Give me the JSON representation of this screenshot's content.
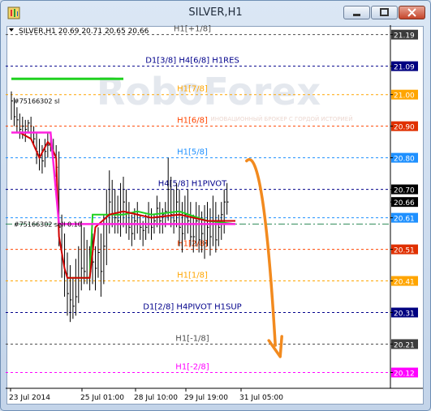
{
  "window": {
    "title": "SILVER,H1",
    "buttons": [
      "minimize",
      "maximize",
      "close"
    ]
  },
  "chart_header": {
    "symbol": "SILVER,H1",
    "ohlc": "20.69 20.71 20.65 20.66",
    "menu_icon": "triangle-down-icon"
  },
  "watermark": {
    "logo_text": "RoboForex",
    "tagline": "ИНОВАЦИОННЫЙ БРОКЕР С ГОРДОЙ ИСТОРИЕЙ"
  },
  "colors": {
    "bullet_levels_green": "#1fd11f",
    "signal_magenta": "#ff22e0",
    "price_red": "#d00000",
    "arrow_orange": "#f28a1e",
    "candles": "#000000"
  },
  "chart_data": {
    "type": "candlestick",
    "symbol": "SILVER",
    "timeframe": "H1",
    "ylim": [
      20.07,
      21.22
    ],
    "price_axis_ticks": [
      "21.19",
      "21.09",
      "21.00",
      "20.90",
      "20.80",
      "20.70",
      "20.66",
      "20.61",
      "20.51",
      "20.41",
      "20.31",
      "20.21",
      "20.12"
    ],
    "current_price": "20.66",
    "time_labels": [
      "23 Jul 2014",
      "25 Jul 01:00",
      "28 Jul 10:00",
      "29 Jul 19:00",
      "31 Jul 05:00"
    ],
    "levels": [
      {
        "label": "H1[+1/8]",
        "value": 21.19,
        "color": "#4d4d4d",
        "style": "dashed",
        "highlight": "#3c3c3c"
      },
      {
        "label": "D1[3/8] H4[6/8] H1RES",
        "value": 21.09,
        "color": "#00008b",
        "style": "dashed",
        "highlight": "#000080"
      },
      {
        "label": "H1[7/8]",
        "value": 21.0,
        "color": "#ffa500",
        "style": "dashed",
        "highlight": "#ffa500"
      },
      {
        "label": "H1[6/8]",
        "value": 20.9,
        "color": "#ff4500",
        "style": "dashed",
        "highlight": "#e03000"
      },
      {
        "label": "H1[5/8]",
        "value": 20.8,
        "color": "#1e90ff",
        "style": "dashed",
        "highlight": "#1e90ff"
      },
      {
        "label": "H4[5/8] H1PIVOT",
        "value": 20.7,
        "color": "#00008b",
        "style": "dashed",
        "highlight": "#000000"
      },
      {
        "label": "",
        "value": 20.61,
        "color": "#1e90ff",
        "style": "dashed",
        "highlight": "#1e90ff"
      },
      {
        "label": "",
        "value": 20.59,
        "color": "#2e8b57",
        "style": "dashdot",
        "highlight": ""
      },
      {
        "label": "H1[2/8]",
        "value": 20.51,
        "color": "#ff4500",
        "style": "dashed",
        "highlight": "#e03000"
      },
      {
        "label": "H1[1/8]",
        "value": 20.41,
        "color": "#ffa500",
        "style": "dashed",
        "highlight": "#ffa500"
      },
      {
        "label": "D1[2/8] H4PIVOT H1SUP",
        "value": 20.31,
        "color": "#00008b",
        "style": "dashed",
        "highlight": "#000080"
      },
      {
        "label": "H1[-1/8]",
        "value": 20.21,
        "color": "#4d4d4d",
        "style": "dashed",
        "highlight": "#3c3c3c"
      },
      {
        "label": "H1[-2/8]",
        "value": 20.12,
        "color": "#ff00ff",
        "style": "dashed",
        "highlight": "#ff00ff"
      }
    ],
    "order_labels": [
      {
        "text": "#75166302 sl",
        "price": 20.98
      },
      {
        "text": "#75166302 sell 0.10",
        "price": 20.59
      }
    ],
    "candles_hlc": [
      [
        21.01,
        20.92,
        20.98
      ],
      [
        20.99,
        20.9,
        20.93
      ],
      [
        20.96,
        20.88,
        20.92
      ],
      [
        20.94,
        20.86,
        20.89
      ],
      [
        20.93,
        20.86,
        20.9
      ],
      [
        20.92,
        20.85,
        20.89
      ],
      [
        20.92,
        20.88,
        20.91
      ],
      [
        20.93,
        20.86,
        20.88
      ],
      [
        20.9,
        20.84,
        20.86
      ],
      [
        20.88,
        20.78,
        20.82
      ],
      [
        20.86,
        20.76,
        20.8
      ],
      [
        20.84,
        20.75,
        20.79
      ],
      [
        20.86,
        20.77,
        20.82
      ],
      [
        20.88,
        20.8,
        20.84
      ],
      [
        20.87,
        20.82,
        20.84
      ],
      [
        20.86,
        20.78,
        20.8
      ],
      [
        20.84,
        20.74,
        20.77
      ],
      [
        20.82,
        20.52,
        20.58
      ],
      [
        20.62,
        20.42,
        20.48
      ],
      [
        20.56,
        20.36,
        20.44
      ],
      [
        20.5,
        20.3,
        20.37
      ],
      [
        20.46,
        20.28,
        20.35
      ],
      [
        20.42,
        20.29,
        20.33
      ],
      [
        20.48,
        20.3,
        20.36
      ],
      [
        20.52,
        20.34,
        20.42
      ],
      [
        20.6,
        20.38,
        20.45
      ],
      [
        20.58,
        20.4,
        20.44
      ],
      [
        20.54,
        20.4,
        20.42
      ],
      [
        20.52,
        20.38,
        20.44
      ],
      [
        20.56,
        20.4,
        20.47
      ],
      [
        20.52,
        20.38,
        20.45
      ],
      [
        20.58,
        20.42,
        20.5
      ],
      [
        20.56,
        20.36,
        20.44
      ],
      [
        20.62,
        20.4,
        20.52
      ],
      [
        20.7,
        20.46,
        20.62
      ],
      [
        20.76,
        20.56,
        20.66
      ],
      [
        20.73,
        20.58,
        20.62
      ],
      [
        20.7,
        20.56,
        20.61
      ],
      [
        20.68,
        20.56,
        20.6
      ],
      [
        20.72,
        20.55,
        20.62
      ],
      [
        20.74,
        20.58,
        20.66
      ],
      [
        20.7,
        20.56,
        20.59
      ],
      [
        20.66,
        20.54,
        20.58
      ],
      [
        20.62,
        20.52,
        20.56
      ],
      [
        20.64,
        20.54,
        20.6
      ],
      [
        20.66,
        20.56,
        20.62
      ],
      [
        20.62,
        20.54,
        20.58
      ],
      [
        20.6,
        20.52,
        20.57
      ],
      [
        20.62,
        20.54,
        20.58
      ],
      [
        20.66,
        20.56,
        20.62
      ],
      [
        20.64,
        20.54,
        20.58
      ],
      [
        20.62,
        20.56,
        20.6
      ],
      [
        20.68,
        20.58,
        20.64
      ],
      [
        20.66,
        20.56,
        20.6
      ],
      [
        20.64,
        20.56,
        20.62
      ],
      [
        20.66,
        20.58,
        20.63
      ],
      [
        20.8,
        20.6,
        20.7
      ],
      [
        20.74,
        20.58,
        20.62
      ],
      [
        20.7,
        20.56,
        20.6
      ],
      [
        20.72,
        20.58,
        20.66
      ],
      [
        20.7,
        20.52,
        20.58
      ],
      [
        20.66,
        20.5,
        20.56
      ],
      [
        20.68,
        20.54,
        20.62
      ],
      [
        20.7,
        20.56,
        20.6
      ],
      [
        20.66,
        20.52,
        20.55
      ],
      [
        20.62,
        20.5,
        20.55
      ],
      [
        20.66,
        20.52,
        20.6
      ],
      [
        20.65,
        20.5,
        20.54
      ],
      [
        20.63,
        20.5,
        20.56
      ],
      [
        20.65,
        20.48,
        20.53
      ],
      [
        20.66,
        20.52,
        20.58
      ],
      [
        20.64,
        20.49,
        20.55
      ],
      [
        20.68,
        20.52,
        20.6
      ],
      [
        20.66,
        20.5,
        20.54
      ],
      [
        20.62,
        20.52,
        20.58
      ],
      [
        20.66,
        20.54,
        20.62
      ],
      [
        20.7,
        20.56,
        20.66
      ],
      [
        20.72,
        20.62,
        20.66
      ]
    ],
    "signal_line_magenta": [
      [
        0,
        20.88
      ],
      [
        13,
        20.88
      ],
      [
        14,
        20.88
      ],
      [
        17,
        20.59
      ],
      [
        18,
        20.59
      ],
      [
        20,
        20.59
      ],
      [
        80,
        20.59
      ]
    ],
    "price_line_green": [
      [
        20,
        20.42
      ],
      [
        28,
        20.42
      ],
      [
        29,
        20.62
      ],
      [
        40,
        20.62
      ],
      [
        45,
        20.63
      ],
      [
        50,
        20.62
      ],
      [
        60,
        20.63
      ],
      [
        70,
        20.6
      ],
      [
        80,
        20.59
      ]
    ],
    "price_line_red": [
      [
        3,
        20.88
      ],
      [
        7,
        20.86
      ],
      [
        10,
        20.8
      ],
      [
        13,
        20.85
      ],
      [
        14,
        20.84
      ],
      [
        16,
        20.8
      ],
      [
        17,
        20.55
      ],
      [
        19,
        20.45
      ],
      [
        20,
        20.42
      ],
      [
        28,
        20.42
      ],
      [
        30,
        20.58
      ],
      [
        35,
        20.62
      ],
      [
        40,
        20.63
      ],
      [
        50,
        20.61
      ],
      [
        60,
        20.62
      ],
      [
        70,
        20.6
      ],
      [
        80,
        20.6
      ]
    ],
    "thick_green_line": {
      "value": 21.05,
      "from": 0,
      "to": 40
    },
    "forecast_arrow": {
      "from": [
        84,
        20.79
      ],
      "via": [
        90,
        20.8
      ],
      "to": [
        96,
        20.17
      ]
    }
  }
}
